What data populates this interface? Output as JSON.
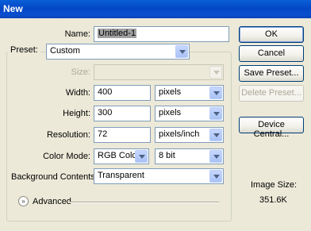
{
  "window": {
    "title": "New"
  },
  "name": {
    "label": "Name:",
    "value": "Untitled-1"
  },
  "preset": {
    "label": "Preset:",
    "value": "Custom"
  },
  "size": {
    "label": "Size:",
    "value": ""
  },
  "width": {
    "label": "Width:",
    "value": "400",
    "unit": "pixels"
  },
  "height": {
    "label": "Height:",
    "value": "300",
    "unit": "pixels"
  },
  "resolution": {
    "label": "Resolution:",
    "value": "72",
    "unit": "pixels/inch"
  },
  "color_mode": {
    "label": "Color Mode:",
    "value": "RGB Color",
    "depth": "8 bit"
  },
  "background": {
    "label": "Background Contents:",
    "value": "Transparent"
  },
  "advanced": {
    "label": "Advanced"
  },
  "buttons": {
    "ok": "OK",
    "cancel": "Cancel",
    "save_preset": "Save Preset...",
    "delete_preset": "Delete Preset...",
    "device_central": "Device Central..."
  },
  "image_size": {
    "label": "Image Size:",
    "value": "351.6K"
  }
}
